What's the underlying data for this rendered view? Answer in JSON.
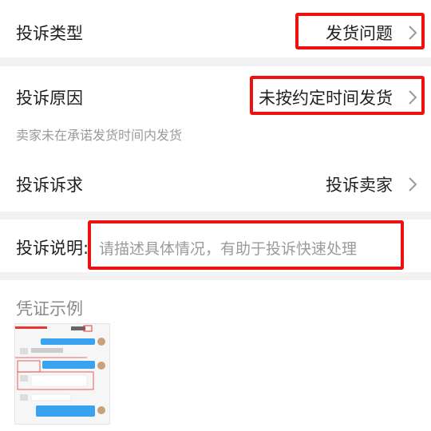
{
  "complaint_type": {
    "label": "投诉类型",
    "value": "发货问题"
  },
  "complaint_reason": {
    "label": "投诉原因",
    "value": "未按约定时间发货",
    "hint": "卖家未在承诺发货时间内发货"
  },
  "complaint_demand": {
    "label": "投诉诉求",
    "value": "投诉卖家"
  },
  "complaint_description": {
    "label": "投诉说明:",
    "placeholder": "请描述具体情况，有助于投诉快速处理"
  },
  "evidence": {
    "title": "凭证示例"
  },
  "colors": {
    "highlight": "#ee1111",
    "placeholder": "#9b9b9b",
    "chat_bubble": "#3aa3ef"
  }
}
